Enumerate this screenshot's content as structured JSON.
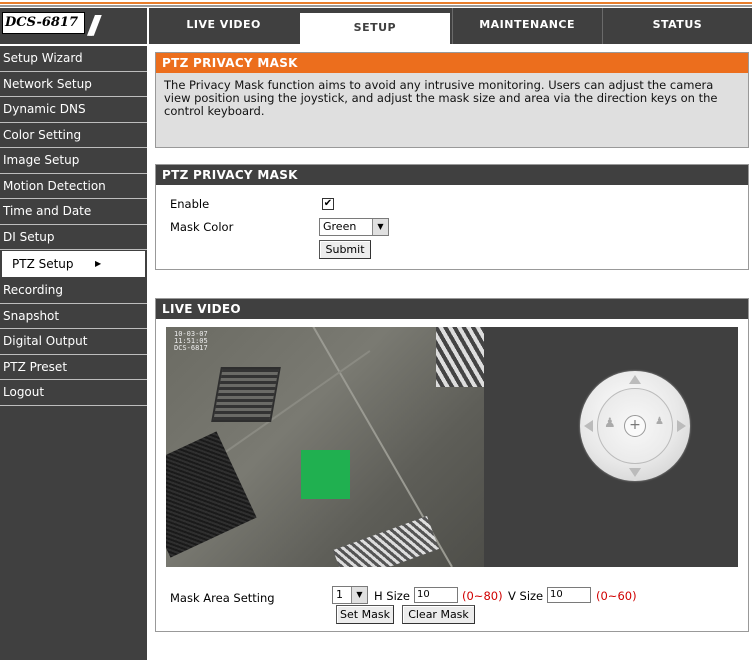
{
  "logo": {
    "model": "DCS-6817",
    "slashes": "///"
  },
  "nav": {
    "tabs": [
      {
        "label": "LIVE VIDEO",
        "active": false
      },
      {
        "label": "SETUP",
        "active": true
      },
      {
        "label": "MAINTENANCE",
        "active": false
      },
      {
        "label": "STATUS",
        "active": false
      }
    ]
  },
  "sidebar": {
    "items": [
      {
        "label": "Setup Wizard"
      },
      {
        "label": "Network Setup"
      },
      {
        "label": "Dynamic DNS"
      },
      {
        "label": "Color Setting"
      },
      {
        "label": "Image Setup"
      },
      {
        "label": "Motion Detection"
      },
      {
        "label": "Time and Date"
      },
      {
        "label": "DI Setup"
      },
      {
        "label": "PTZ Setup",
        "active": true
      },
      {
        "label": "Recording"
      },
      {
        "label": "Snapshot"
      },
      {
        "label": "Digital Output"
      },
      {
        "label": "PTZ Preset"
      },
      {
        "label": "Logout"
      }
    ]
  },
  "intro": {
    "title": "PTZ PRIVACY MASK",
    "text": "The Privacy Mask function aims to avoid any intrusive monitoring. Users can adjust the camera view position using the joystick, and adjust the mask size and area via the direction keys on the control keyboard."
  },
  "settings": {
    "title": "PTZ PRIVACY MASK",
    "enable_label": "Enable",
    "enable_checked": true,
    "check_mark": "✔",
    "mask_color_label": "Mask Color",
    "mask_color_value": "Green",
    "submit_label": "Submit"
  },
  "live": {
    "title": "LIVE VIDEO",
    "osd_date": "10-03-07",
    "osd_time": "11:51:05",
    "osd_name": "DCS-6817",
    "mask_color": "#20b050",
    "mask_area_label": "Mask Area Setting",
    "mask_index": "1",
    "h_size_label": "H Size",
    "h_size_value": "10",
    "h_range": "(0~80)",
    "v_size_label": "V Size",
    "v_size_value": "10",
    "v_range": "(0~60)",
    "set_mask_label": "Set Mask",
    "clear_mask_label": "Clear Mask"
  }
}
